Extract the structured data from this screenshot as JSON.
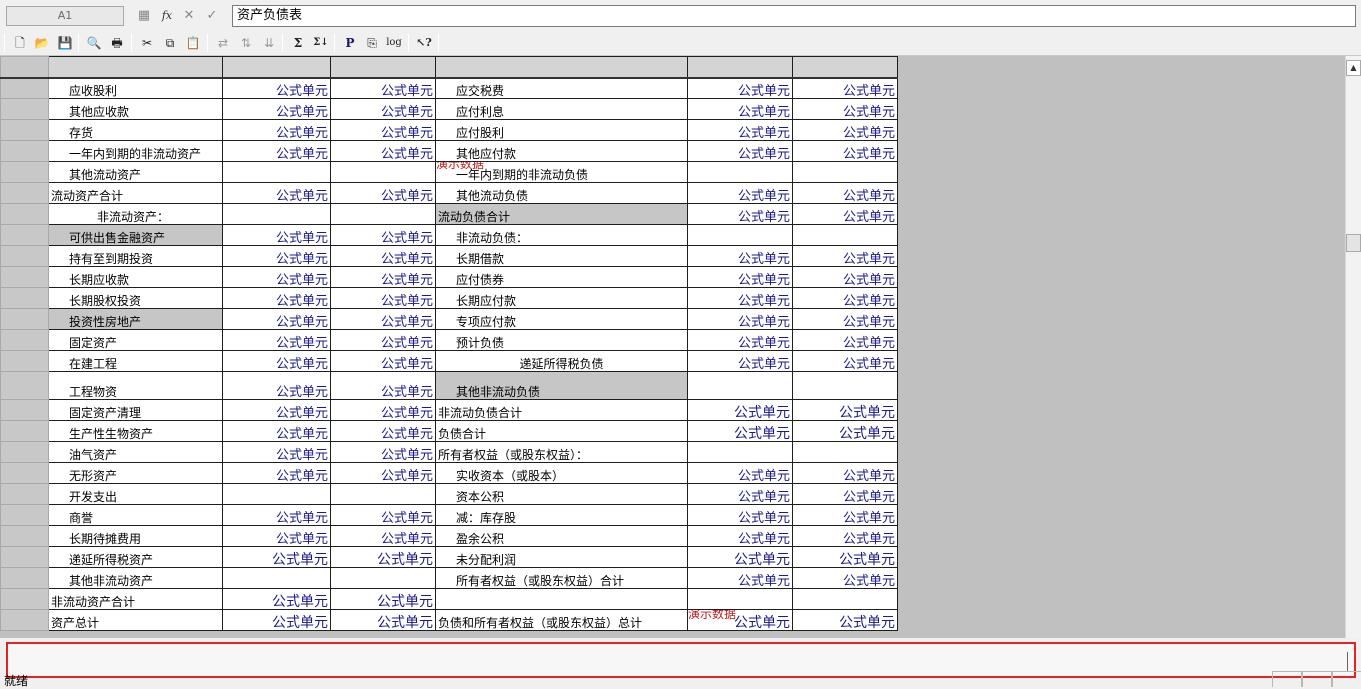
{
  "formula_bar": {
    "cell_ref": "A1",
    "fx_label": "fx",
    "cancel_glyph": "✕",
    "confirm_glyph": "✓",
    "calc_glyph": "▦",
    "content": "资产负债表"
  },
  "toolbar": {
    "new": "🗋",
    "open": "📂",
    "save": "💾",
    "preview": "🔍",
    "print": "🖶",
    "cut": "✂",
    "copy": "⧉",
    "paste": "📋",
    "t1": "⇄",
    "t2": "⇅",
    "t3": "⇊",
    "sum": "Σ",
    "sum_down": "Σ↓",
    "p": "P",
    "page": "⎘",
    "log": "log",
    "help": "↖?"
  },
  "watermark": "演示数据",
  "value_text": "公式单元",
  "rows": [
    {
      "a": "应收股利",
      "ai": 1,
      "b": "公式单元",
      "c": "公式单元",
      "d": "应交税费",
      "di": 1,
      "e": "公式单元",
      "f": "公式单元"
    },
    {
      "a": "其他应收款",
      "ai": 1,
      "b": "公式单元",
      "c": "公式单元",
      "d": "应付利息",
      "di": 1,
      "e": "公式单元",
      "f": "公式单元"
    },
    {
      "a": "存货",
      "ai": 1,
      "b": "公式单元",
      "c": "公式单元",
      "d": "应付股利",
      "di": 1,
      "e": "公式单元",
      "f": "公式单元"
    },
    {
      "a": "一年内到期的非流动资产",
      "ai": 1,
      "b": "公式单元",
      "c": "公式单元",
      "d": "其他应付款",
      "di": 1,
      "e": "公式单元",
      "f": "公式单元"
    },
    {
      "a": "其他流动资产",
      "ai": 1,
      "b": "",
      "c": "",
      "d": "一年内到期的非流动负债",
      "di": 1,
      "e": "",
      "f": "",
      "demo": true
    },
    {
      "a": "流动资产合计",
      "ai": 0,
      "b": "公式单元",
      "c": "公式单元",
      "d": "其他流动负债",
      "di": 1,
      "e": "公式单元",
      "f": "公式单元"
    },
    {
      "a": "非流动资产：",
      "ai": 2,
      "b": "",
      "c": "",
      "d": "流动负债合计",
      "di": 0,
      "dg": true,
      "e": "公式单元",
      "f": "公式单元"
    },
    {
      "a": "可供出售金融资产",
      "ai": 1,
      "ag": true,
      "b": "公式单元",
      "c": "公式单元",
      "d": "非流动负债：",
      "di": 1,
      "e": "",
      "f": ""
    },
    {
      "a": "持有至到期投资",
      "ai": 1,
      "b": "公式单元",
      "c": "公式单元",
      "d": "长期借款",
      "di": 1,
      "e": "公式单元",
      "f": "公式单元"
    },
    {
      "a": "长期应收款",
      "ai": 1,
      "b": "公式单元",
      "c": "公式单元",
      "d": "应付债券",
      "di": 1,
      "e": "公式单元",
      "f": "公式单元"
    },
    {
      "a": "长期股权投资",
      "ai": 1,
      "b": "公式单元",
      "c": "公式单元",
      "d": "长期应付款",
      "di": 1,
      "e": "公式单元",
      "f": "公式单元"
    },
    {
      "a": "投资性房地产",
      "ai": 1,
      "ag": true,
      "b": "公式单元",
      "c": "公式单元",
      "d": "专项应付款",
      "di": 1,
      "e": "公式单元",
      "f": "公式单元"
    },
    {
      "a": "固定资产",
      "ai": 1,
      "b": "公式单元",
      "c": "公式单元",
      "d": "预计负债",
      "di": 1,
      "e": "公式单元",
      "f": "公式单元"
    },
    {
      "a": "在建工程",
      "ai": 1,
      "b": "公式单元",
      "c": "公式单元",
      "d": "递延所得税负债",
      "di": 3,
      "e": "公式单元",
      "f": "公式单元"
    },
    {
      "a": "工程物资",
      "ai": 1,
      "b": "公式单元",
      "c": "公式单元",
      "d": "其他非流动负债",
      "di": 1,
      "dg": true,
      "e": "",
      "f": "",
      "tall": true
    },
    {
      "a": "固定资产清理",
      "ai": 1,
      "b": "公式单元",
      "c": "公式单元",
      "d": "非流动负债合计",
      "di": 0,
      "e": "公式单元",
      "f": "公式单元",
      "elg": true
    },
    {
      "a": "生产性生物资产",
      "ai": 1,
      "b": "公式单元",
      "c": "公式单元",
      "d": "负债合计",
      "di": 0,
      "e": "公式单元",
      "f": "公式单元",
      "elg": true
    },
    {
      "a": "油气资产",
      "ai": 1,
      "b": "公式单元",
      "c": "公式单元",
      "d": "所有者权益（或股东权益）：",
      "di": 0,
      "e": "",
      "f": ""
    },
    {
      "a": "无形资产",
      "ai": 1,
      "b": "公式单元",
      "c": "公式单元",
      "d": "实收资本（或股本）",
      "di": 1,
      "e": "公式单元",
      "f": "公式单元"
    },
    {
      "a": "开发支出",
      "ai": 1,
      "b": "",
      "c": "",
      "d": "资本公积",
      "di": 1,
      "e": "公式单元",
      "f": "公式单元"
    },
    {
      "a": "商誉",
      "ai": 1,
      "b": "公式单元",
      "c": "公式单元",
      "d": "减：库存股",
      "di": 1,
      "e": "公式单元",
      "f": "公式单元"
    },
    {
      "a": "长期待摊费用",
      "ai": 1,
      "b": "公式单元",
      "c": "公式单元",
      "d": "盈余公积",
      "di": 1,
      "e": "公式单元",
      "f": "公式单元"
    },
    {
      "a": "递延所得税资产",
      "ai": 1,
      "b": "公式单元",
      "c": "公式单元",
      "d": "未分配利润",
      "di": 1,
      "e": "公式单元",
      "f": "公式单元",
      "blg": true,
      "elg": true
    },
    {
      "a": "其他非流动资产",
      "ai": 1,
      "b": "",
      "c": "",
      "d": "所有者权益（或股东权益）合计",
      "di": 1,
      "e": "公式单元",
      "f": "公式单元"
    },
    {
      "a": "非流动资产合计",
      "ai": 0,
      "b": "公式单元",
      "c": "公式单元",
      "d": "",
      "di": 0,
      "e": "",
      "f": "",
      "blg": true
    },
    {
      "a": "资产总计",
      "ai": 0,
      "b": "公式单元",
      "c": "公式单元",
      "d": "负债和所有者权益（或股东权益）总计",
      "di": 0,
      "e": "公式单元",
      "f": "公式单元",
      "blg": true,
      "elg": true,
      "demo2": true
    }
  ],
  "status": {
    "text": "就绪"
  }
}
